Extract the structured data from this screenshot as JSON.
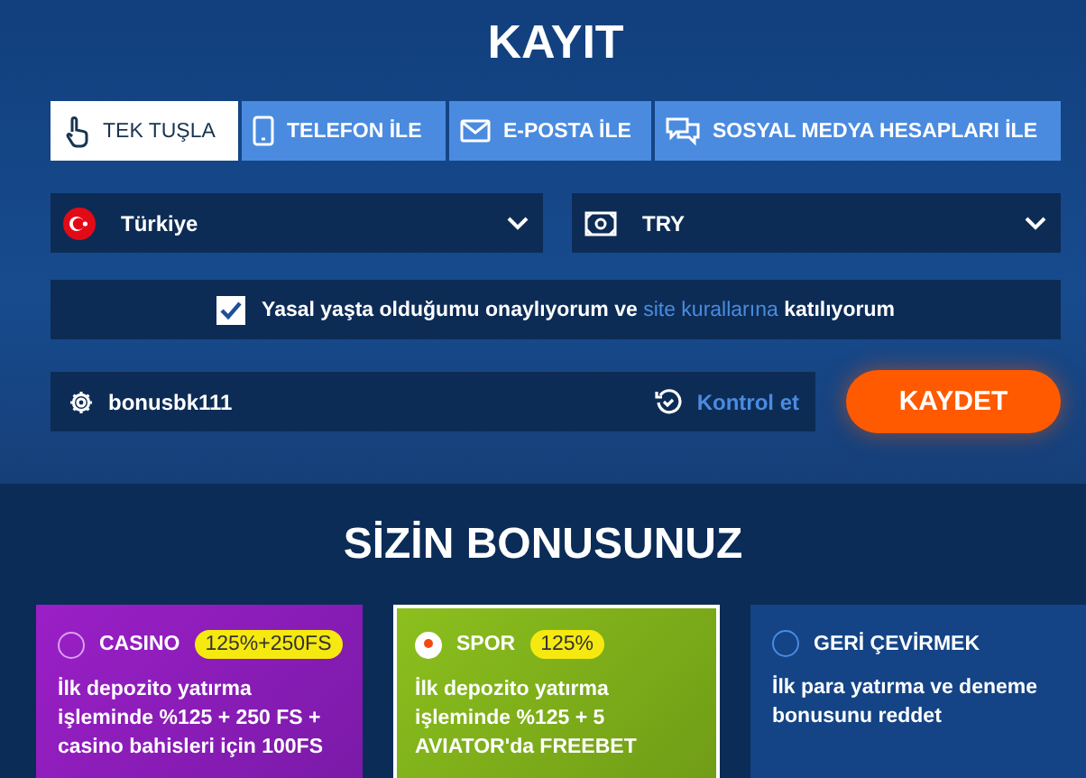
{
  "title": "KAYIT",
  "tabs": [
    {
      "label": "TEK TUŞLA",
      "kind": "hand",
      "selected": true
    },
    {
      "label": "TELEFON İLE",
      "kind": "phone",
      "selected": false
    },
    {
      "label": "E-POSTA İLE",
      "kind": "mail",
      "selected": false
    },
    {
      "label": "SOSYAL MEDYA HESAPLARI İLE",
      "kind": "chat",
      "selected": false
    }
  ],
  "country_select": {
    "value": "Türkiye"
  },
  "currency_select": {
    "value": "TRY"
  },
  "agreement": {
    "checked": true,
    "text_before": "Yasal yaşta olduğumu onaylıyorum ve",
    "link": "site kurallarına",
    "text_after": "katılıyorum"
  },
  "promo": {
    "value": "bonusbk111",
    "check_link": "Kontrol et"
  },
  "submit_button": "KAYDET",
  "bonus_title": "SİZİN BONUSUNUZ",
  "bonuses": [
    {
      "kind": "casino",
      "name": "CASINO",
      "badge": "125%+250FS",
      "description": "İlk depozito yatırma işleminde %125 + 250 FS + casino bahisleri için 100FS",
      "selected": false
    },
    {
      "kind": "sport",
      "name": "SPOR",
      "badge": "125%",
      "description": "İlk depozito yatırma işleminde %125 +  5 AVIATOR'da FREEBET",
      "selected": true
    },
    {
      "kind": "decline",
      "name": "GERİ ÇEVİRMEK",
      "description": "İlk para yatırma ve deneme bonusunu reddet",
      "selected": false
    }
  ]
}
